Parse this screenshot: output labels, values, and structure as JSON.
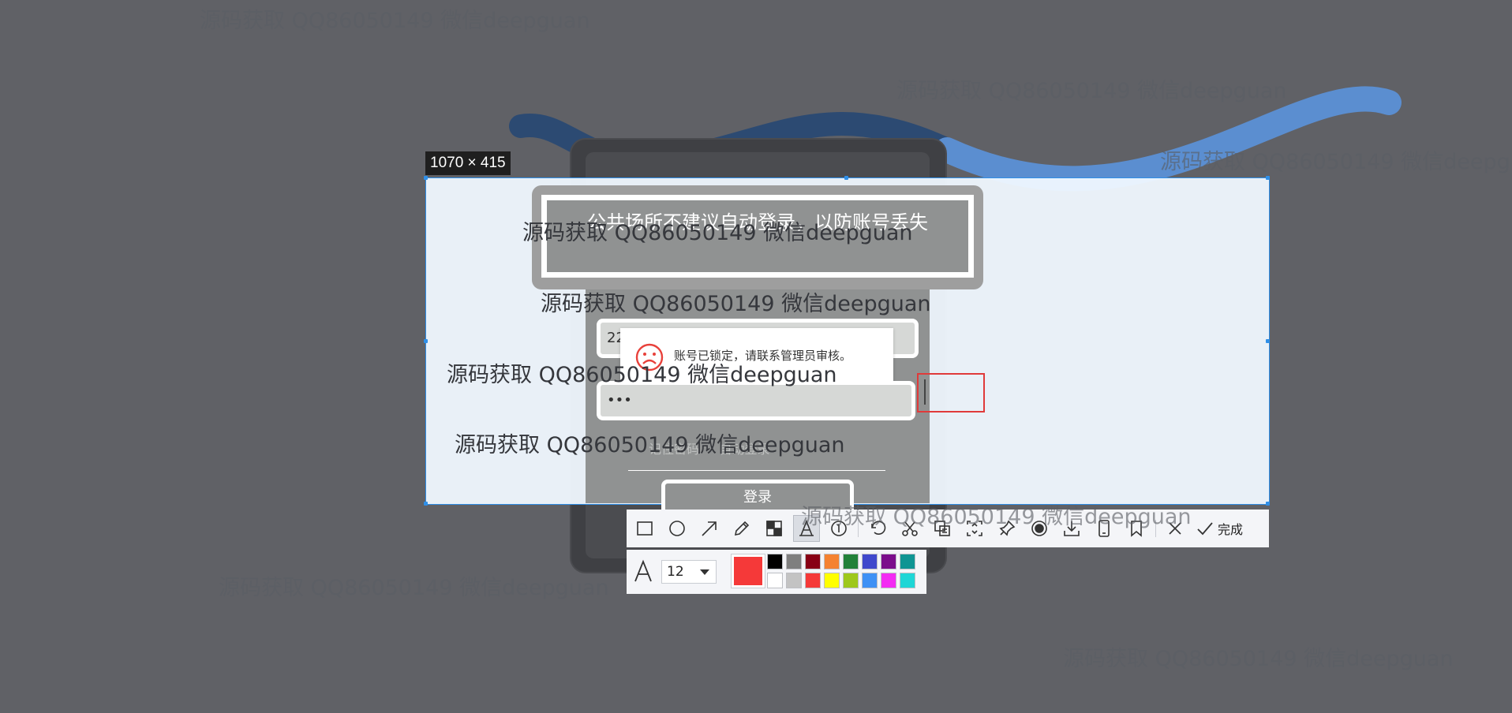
{
  "selection": {
    "size_label": "1070 × 415"
  },
  "login": {
    "tip": "公共场所不建议自动登录，以防账号丢失",
    "username_value": "22",
    "password_value": "•••",
    "toast_text": "账号已锁定，请联系管理员审核。",
    "remember_label": "记住密码",
    "auto_login_label": "自动登录",
    "login_button": "登录"
  },
  "toolbar": {
    "tools": [
      "rectangle-tool",
      "ellipse-tool",
      "arrow-tool",
      "pencil-tool",
      "mosaic-tool",
      "text-tool",
      "number-tool",
      "undo-tool",
      "cut-tool",
      "ocr-tool",
      "scroll-capture-tool",
      "pin-tool",
      "record-tool",
      "save-tool",
      "save-to-phone-tool",
      "bookmark-tool",
      "cancel-tool"
    ],
    "selected_tool": "text-tool",
    "done_label": "完成"
  },
  "text_options": {
    "font_size": "12",
    "current_color": "#f53939",
    "palette": [
      "#000000",
      "#7f7f7f",
      "#880015",
      "#f58231",
      "#22813a",
      "#3f48cc",
      "#7b0d8b",
      "#0f9593",
      "#ffffff",
      "#c3c3c3",
      "#f53939",
      "#ffff00",
      "#9ec81c",
      "#3f91f5",
      "#f32bf3",
      "#1fd6d6"
    ]
  },
  "watermark": {
    "text": "源码获取 QQ86050149 微信deepguan"
  }
}
